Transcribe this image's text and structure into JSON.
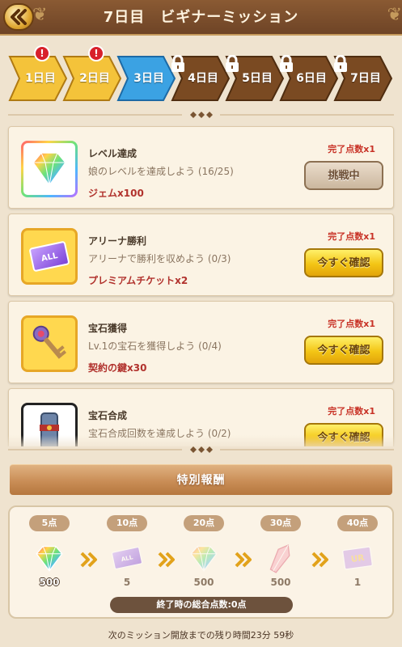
{
  "header": {
    "title": "7日目　ビギナーミッション",
    "back_icon": "chevron-left-double-icon"
  },
  "days": [
    {
      "label": "1日目",
      "state": "done",
      "alert": "!"
    },
    {
      "label": "2日目",
      "state": "done",
      "alert": "!"
    },
    {
      "label": "3日目",
      "state": "current"
    },
    {
      "label": "4日目",
      "state": "locked"
    },
    {
      "label": "5日目",
      "state": "locked"
    },
    {
      "label": "6日目",
      "state": "locked"
    },
    {
      "label": "7日目",
      "state": "locked"
    }
  ],
  "missions": [
    {
      "title": "レベル達成",
      "desc": "娘のレベルを達成しよう (16/25)",
      "reward": "ジェムx100",
      "points": "完了点数x1",
      "button": "挑戦中",
      "button_style": "gray",
      "icon": "gem-icon"
    },
    {
      "title": "アリーナ勝利",
      "desc": "アリーナで勝利を収めよう (0/3)",
      "reward": "プレミアムチケットx2",
      "points": "完了点数x1",
      "button": "今すぐ確認",
      "button_style": "yellow",
      "icon": "ticket-icon"
    },
    {
      "title": "宝石獲得",
      "desc": "Lv.1の宝石を獲得しよう (0/4)",
      "reward": "契約の鍵x30",
      "points": "完了点数x1",
      "button": "今すぐ確認",
      "button_style": "yellow",
      "icon": "key-icon"
    },
    {
      "title": "宝石合成",
      "desc": "宝石合成回数を達成しよう (0/2)",
      "reward": "",
      "points": "完了点数x1",
      "button": "今すぐ確認",
      "button_style": "yellow",
      "icon": "scroll-icon"
    }
  ],
  "special_reward": {
    "label": "特別報酬"
  },
  "bonus_steps": [
    {
      "points": "5点",
      "qty": "500",
      "icon": "gem-icon",
      "locked": false
    },
    {
      "points": "10点",
      "qty": "5",
      "icon": "ticket-icon",
      "locked": true
    },
    {
      "points": "20点",
      "qty": "500",
      "icon": "gem-icon",
      "locked": true
    },
    {
      "points": "30点",
      "qty": "500",
      "icon": "crystal-shard-icon",
      "locked": true
    },
    {
      "points": "40点",
      "qty": "1",
      "icon": "ur-ticket-icon",
      "locked": true
    }
  ],
  "total_points": "終了時の総合点数:0点",
  "footer": "次のミッション開放までの残り時間23分 59秒",
  "colors": {
    "header_bg": "#7a4c2b",
    "current_day": "#3ba2e3",
    "done_day": "#f4c33a",
    "locked_day": "#7a4a22",
    "reward_text": "#b1322d",
    "points_text": "#c83226"
  }
}
